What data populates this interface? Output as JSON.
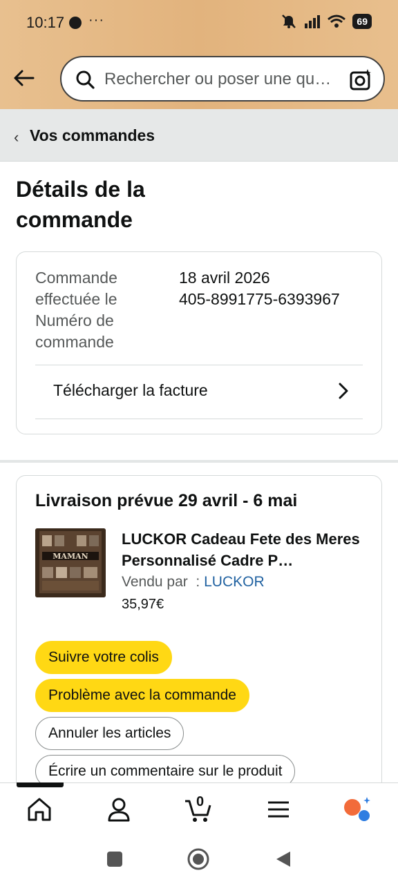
{
  "status_bar": {
    "time": "10:17",
    "more": "···",
    "battery": "69"
  },
  "search": {
    "placeholder": "Rechercher ou poser une qu…"
  },
  "breadcrumb": {
    "label": "Vos commandes"
  },
  "page_title": "Détails de la commande",
  "order_info": {
    "date_label": "Commande effectuée le",
    "date_value": "18 avril 2026",
    "number_label": "Numéro de commande",
    "number_value": "405-8991775-6393967",
    "invoice_label": "Télécharger la facture"
  },
  "shipment": {
    "delivery": "Livraison prévue 29 avril - 6 mai",
    "product_title": "LUCKOR Cadeau Fete des Meres Personnalisé Cadre P…",
    "sold_by_label": "Vendu par  : ",
    "seller": "LUCKOR",
    "price": "35,97€",
    "actions": {
      "track": "Suivre votre colis",
      "problem": "Problème avec la commande",
      "cancel": "Annuler les articles",
      "review": "Écrire un commentaire sur le produit"
    }
  },
  "bottom_nav": {
    "cart_count": "0"
  },
  "colors": {
    "header_bg": "#e2b37d",
    "button_yellow": "#ffd814",
    "link_blue": "#2162a1"
  }
}
